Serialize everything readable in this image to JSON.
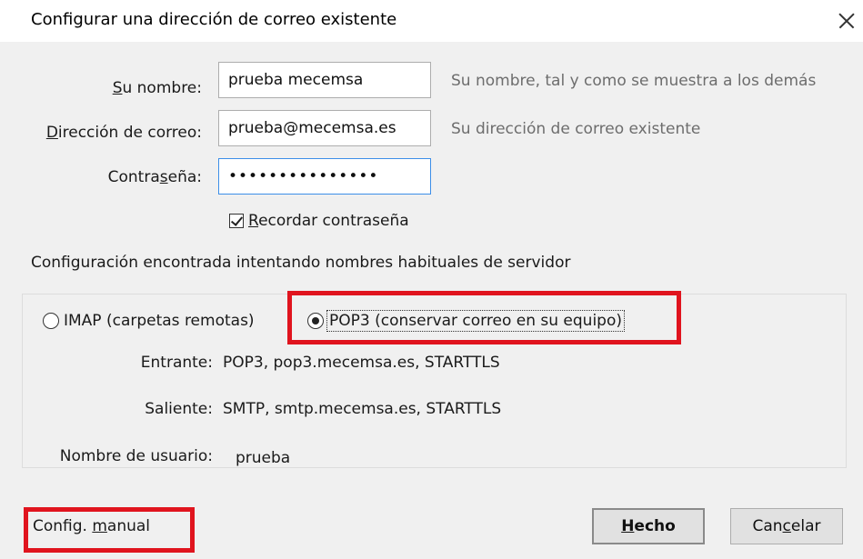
{
  "dialog": {
    "title": "Configurar una dirección de correo existente"
  },
  "form": {
    "name": {
      "label_pre": "",
      "label_key": "S",
      "label_post": "u nombre:",
      "value": "prueba mecemsa",
      "hint": "Su nombre, tal y como se muestra a los demás"
    },
    "email": {
      "label_pre": "",
      "label_key": "D",
      "label_post": "irección de correo:",
      "value": "prueba@mecemsa.es",
      "hint": "Su dirección de correo existente"
    },
    "password": {
      "label_pre": "Contra",
      "label_key": "s",
      "label_post": "eña:",
      "value": "•••••••••••••••"
    },
    "remember": {
      "checked": true,
      "label_key": "R",
      "label_post": "ecordar contraseña"
    }
  },
  "status_text": "Configuración encontrada intentando nombres habituales de servidor",
  "protocol": {
    "imap_label": "IMAP (carpetas remotas)",
    "pop3_label": "POP3 (conservar correo en su equipo)",
    "selected": "POP3"
  },
  "server_info": {
    "incoming_label": "Entrante:",
    "incoming_value": "POP3, pop3.mecemsa.es, STARTTLS",
    "outgoing_label": "Saliente:",
    "outgoing_value": "SMTP, smtp.mecemsa.es, STARTTLS",
    "username_label": "Nombre de usuario:",
    "username_value": "prueba"
  },
  "buttons": {
    "manual_pre": "Config. ",
    "manual_key": "m",
    "manual_post": "anual",
    "done_key": "H",
    "done_post": "echo",
    "cancel_pre": "Can",
    "cancel_key": "c",
    "cancel_post": "elar"
  },
  "colors": {
    "highlight": "#e0141e",
    "focus_border": "#3c8ee8",
    "dialog_bg": "#f0f0f0"
  }
}
